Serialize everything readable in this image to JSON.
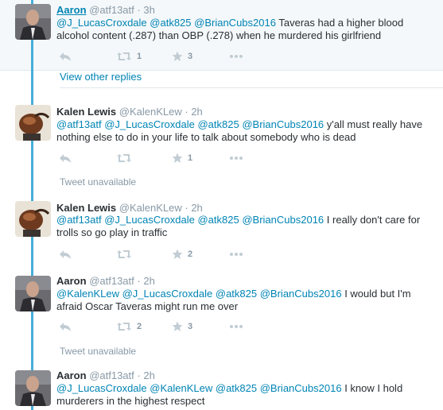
{
  "tweets": [
    {
      "fullname": "Aaron",
      "handle": "@atf13atf",
      "separator": "·",
      "time": "3h",
      "mentions": [
        "@J_LucasCroxdale",
        "@atk825",
        "@BrianCubs2016"
      ],
      "text": "Taveras had a higher blood alcohol content (.287) than OBP (.278) when he murdered his girlfriend",
      "retweets": "1",
      "favorites": "3"
    },
    {
      "fullname": "Kalen Lewis",
      "handle": "@KalenKLew",
      "separator": "·",
      "time": "2h",
      "mentions": [
        "@atf13atf",
        "@J_LucasCroxdale",
        "@atk825",
        "@BrianCubs2016"
      ],
      "text": "y'all must really have nothing else to do in your life to talk about somebody who is dead",
      "retweets": "",
      "favorites": "1"
    },
    {
      "fullname": "Kalen Lewis",
      "handle": "@KalenKLew",
      "separator": "·",
      "time": "2h",
      "mentions": [
        "@atf13atf",
        "@J_LucasCroxdale",
        "@atk825",
        "@BrianCubs2016"
      ],
      "text": "I really don't care for trolls so go play in traffic",
      "retweets": "",
      "favorites": "2"
    },
    {
      "fullname": "Aaron",
      "handle": "@atf13atf",
      "separator": "·",
      "time": "2h",
      "mentions": [
        "@KalenKLew",
        "@J_LucasCroxdale",
        "@atk825",
        "@BrianCubs2016"
      ],
      "text": "I would but I'm afraid Oscar Taveras might run me over",
      "retweets": "2",
      "favorites": "3"
    },
    {
      "fullname": "Aaron",
      "handle": "@atf13atf",
      "separator": "·",
      "time": "2h",
      "mentions": [
        "@J_LucasCroxdale",
        "@KalenKLew",
        "@atk825",
        "@BrianCubs2016"
      ],
      "text": "I know I hold murderers in the highest respect"
    }
  ],
  "view_other_replies": "View other replies",
  "tweet_unavailable": "Tweet unavailable",
  "icons": {
    "reply": "reply-icon",
    "retweet": "retweet-icon",
    "favorite": "star-icon",
    "more": "more-icon"
  },
  "colors": {
    "thread_line": "#45aeda",
    "link": "#0084b4",
    "muted": "#8899a6",
    "text": "#292f33"
  }
}
